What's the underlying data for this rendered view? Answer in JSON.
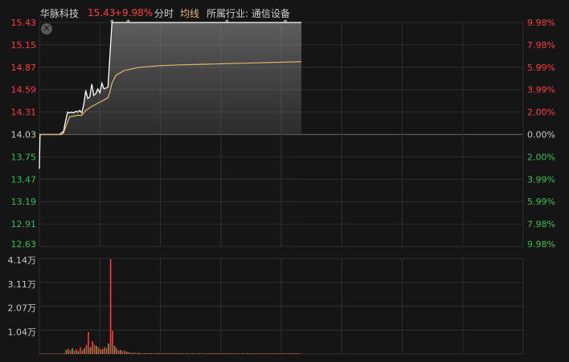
{
  "header": {
    "stock_name": "华脉科技",
    "price": "15.43",
    "change_pct": "+9.98%",
    "mode_label": "分时",
    "avg_label": "均线",
    "industry_label": "所属行业: 通信设备"
  },
  "colors": {
    "background": "#151515",
    "up": "#ff3b3b",
    "down": "#2fbf4f",
    "price_line": "#ffffff",
    "avg_line": "#e6b56a",
    "grid": "#2e2e2e",
    "gray": "#c8c8c8"
  },
  "icons": {
    "close": "close-icon"
  },
  "chart_data": [
    {
      "type": "line",
      "prev_close": 14.03,
      "ylim": [
        12.63,
        15.43
      ],
      "y_ticks_left": [
        "15.43",
        "15.15",
        "14.87",
        "14.59",
        "14.31",
        "14.03",
        "13.75",
        "13.47",
        "13.19",
        "12.91",
        "12.63"
      ],
      "y_ticks_right": [
        "9.98%",
        "7.98%",
        "5.99%",
        "3.99%",
        "2.00%",
        "0.00%",
        "2.00%",
        "3.99%",
        "5.99%",
        "7.98%",
        "9.98%"
      ],
      "total_minutes": 240,
      "minutes_shown": 130,
      "series": [
        {
          "name": "price",
          "points": [
            [
              0,
              13.6
            ],
            [
              0.3,
              14.03
            ],
            [
              1,
              14.03
            ],
            [
              5,
              14.03
            ],
            [
              10,
              14.03
            ],
            [
              12,
              14.07
            ],
            [
              13,
              14.2
            ],
            [
              14,
              14.31
            ],
            [
              15,
              14.3
            ],
            [
              16,
              14.31
            ],
            [
              17,
              14.3
            ],
            [
              18,
              14.32
            ],
            [
              19,
              14.31
            ],
            [
              20,
              14.33
            ],
            [
              21,
              14.3
            ],
            [
              22,
              14.4
            ],
            [
              23,
              14.58
            ],
            [
              24,
              14.48
            ],
            [
              25,
              14.5
            ],
            [
              26,
              14.66
            ],
            [
              27,
              14.52
            ],
            [
              28,
              14.54
            ],
            [
              29,
              14.6
            ],
            [
              30,
              14.55
            ],
            [
              31,
              14.67
            ],
            [
              32,
              14.6
            ],
            [
              34,
              14.62
            ],
            [
              36,
              15.43
            ],
            [
              130,
              15.43
            ]
          ]
        },
        {
          "name": "均线",
          "points": [
            [
              0,
              14.03
            ],
            [
              11,
              14.03
            ],
            [
              12,
              14.05
            ],
            [
              13,
              14.12
            ],
            [
              15,
              14.25
            ],
            [
              17,
              14.26
            ],
            [
              19,
              14.27
            ],
            [
              21,
              14.27
            ],
            [
              23,
              14.33
            ],
            [
              26,
              14.38
            ],
            [
              29,
              14.42
            ],
            [
              32,
              14.46
            ],
            [
              34,
              14.49
            ],
            [
              35,
              14.56
            ],
            [
              36,
              14.67
            ],
            [
              38,
              14.77
            ],
            [
              42,
              14.83
            ],
            [
              50,
              14.87
            ],
            [
              60,
              14.89
            ],
            [
              70,
              14.9
            ],
            [
              85,
              14.91
            ],
            [
              100,
              14.92
            ],
            [
              115,
              14.93
            ],
            [
              130,
              14.94
            ]
          ]
        }
      ],
      "limit_markers": [
        36,
        44,
        93,
        122
      ]
    },
    {
      "type": "bar",
      "y_ticks": [
        "4.14万",
        "3.11万",
        "2.07万",
        "1.04万"
      ],
      "ylim": [
        0,
        4.14
      ],
      "unit": "万",
      "values": [
        0.02,
        0.02,
        0.02,
        0.02,
        0.02,
        0.02,
        0.02,
        0.02,
        0.02,
        0.02,
        0.02,
        0.02,
        0.04,
        0.18,
        0.22,
        0.15,
        0.25,
        0.14,
        0.2,
        0.12,
        0.3,
        0.16,
        0.25,
        0.38,
        0.95,
        0.3,
        0.55,
        0.4,
        0.35,
        0.28,
        0.2,
        0.22,
        0.3,
        0.25,
        0.45,
        4.1,
        1.0,
        0.35,
        0.25,
        0.15,
        0.18,
        0.12,
        0.15,
        0.1,
        0.08,
        0.05,
        0.05,
        0.05,
        0.04,
        0.05,
        0.04,
        0.03,
        0.04,
        0.03,
        0.04,
        0.03,
        0.03,
        0.03,
        0.04,
        0.03,
        0.03,
        0.03,
        0.03,
        0.03,
        0.04,
        0.03,
        0.03,
        0.03,
        0.03,
        0.03,
        0.03,
        0.03,
        0.03,
        0.03,
        0.03,
        0.03,
        0.03,
        0.03,
        0.03,
        0.03,
        0.03,
        0.03,
        0.03,
        0.03,
        0.03,
        0.03,
        0.03,
        0.03,
        0.03,
        0.03,
        0.03,
        0.03,
        0.03,
        0.03,
        0.03,
        0.03,
        0.03,
        0.03,
        0.03,
        0.03,
        0.03,
        0.03,
        0.03,
        0.03,
        0.03,
        0.03,
        0.03,
        0.03,
        0.03,
        0.03,
        0.03,
        0.03,
        0.03,
        0.03,
        0.03,
        0.03,
        0.03,
        0.03,
        0.03,
        0.03,
        0.03,
        0.03,
        0.03,
        0.03,
        0.03,
        0.03,
        0.03,
        0.03,
        0.03,
        0.03
      ]
    }
  ]
}
